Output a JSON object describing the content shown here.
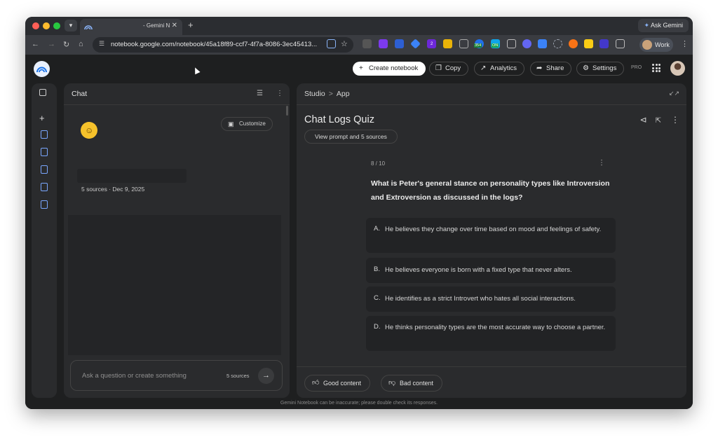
{
  "browser": {
    "tab_title": "- Gemini N",
    "new_tab": "+",
    "ask_gemini": "Ask Gemini",
    "url": "notebook.google.com/notebook/45a18f89-ccf7-4f7a-8086-3ec45413...",
    "work_profile": "Work",
    "ext_badges": [
      "2",
      "354",
      "ON"
    ]
  },
  "header": {
    "create_notebook": "Create notebook",
    "copy": "Copy",
    "analytics": "Analytics",
    "share": "Share",
    "settings": "Settings",
    "tier": "PRO"
  },
  "chat": {
    "title": "Chat",
    "customize": "Customize",
    "meta": "5 sources · Dec 9, 2025",
    "input_placeholder": "Ask a question or create something",
    "sources_count": "5 sources"
  },
  "studio": {
    "breadcrumb_root": "Studio",
    "breadcrumb_sep": ">",
    "breadcrumb_leaf": "App",
    "quiz_title": "Chat Logs Quiz",
    "view_prompt": "View prompt and 5 sources",
    "progress": "8 / 10",
    "question": "What is Peter's general stance on personality types like Introversion and Extroversion as discussed in the logs?",
    "options": [
      {
        "letter": "A.",
        "text": "He believes they change over time based on mood and feelings of safety."
      },
      {
        "letter": "B.",
        "text": "He believes everyone is born with a fixed type that never alters."
      },
      {
        "letter": "C.",
        "text": "He identifies as a strict Introvert who hates all social interactions."
      },
      {
        "letter": "D.",
        "text": "He thinks personality types are the most accurate way to choose a partner."
      }
    ],
    "good_content": "Good content",
    "bad_content": "Bad content"
  },
  "footer": {
    "disclaimer": "Gemini Notebook can be inaccurate; please double check its responses."
  },
  "colors": {
    "app_bg": "#1e1f20",
    "panel_bg": "#2a2b2d",
    "accent_doc": "#7aa7ff",
    "primary_btn": "#ffffff"
  }
}
